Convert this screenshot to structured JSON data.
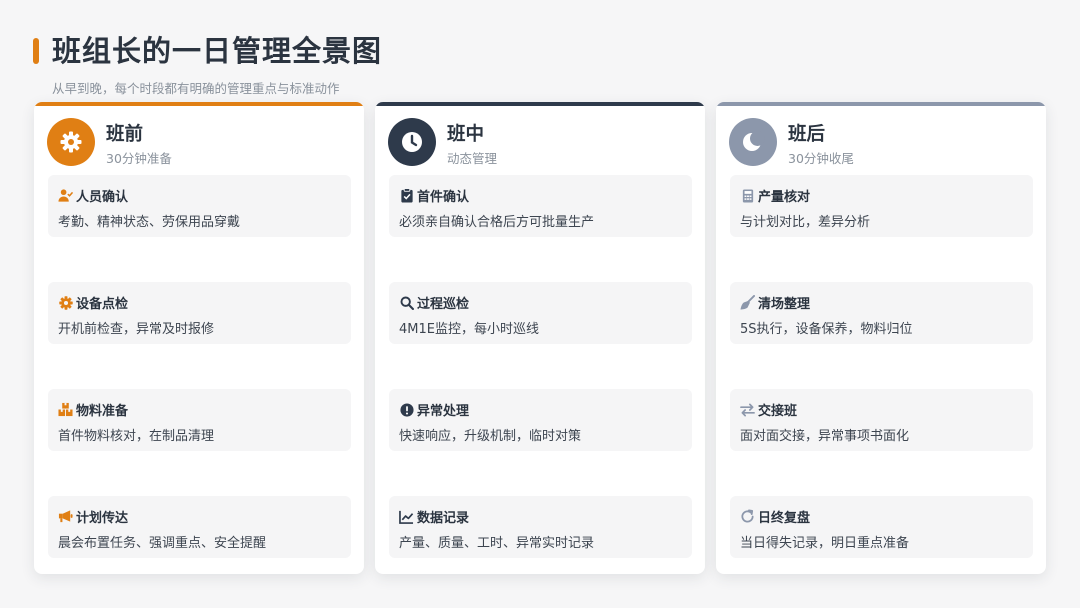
{
  "title": "班组长的一日管理全景图",
  "subtitle": "从早到晚，每个时段都有明确的管理重点与标准动作",
  "colors": {
    "accent_orange": "#e07f14",
    "navy": "#2e3a4b",
    "slate": "#8c97ab"
  },
  "columns": [
    {
      "title": "班前",
      "subtitle": "30分钟准备",
      "icon": "gear-icon",
      "items": [
        {
          "icon": "user-check-icon",
          "title": "人员确认",
          "desc": "考勤、精神状态、劳保用品穿戴"
        },
        {
          "icon": "cog-icon",
          "title": "设备点检",
          "desc": "开机前检查，异常及时报修"
        },
        {
          "icon": "boxes-icon",
          "title": "物料准备",
          "desc": "首件物料核对，在制品清理"
        },
        {
          "icon": "megaphone-icon",
          "title": "计划传达",
          "desc": "晨会布置任务、强调重点、安全提醒"
        }
      ]
    },
    {
      "title": "班中",
      "subtitle": "动态管理",
      "icon": "clock-icon",
      "items": [
        {
          "icon": "clipboard-check-icon",
          "title": "首件确认",
          "desc": "必须亲自确认合格后方可批量生产"
        },
        {
          "icon": "search-icon",
          "title": "过程巡检",
          "desc": "4M1E监控，每小时巡线"
        },
        {
          "icon": "alert-icon",
          "title": "异常处理",
          "desc": "快速响应，升级机制，临时对策"
        },
        {
          "icon": "line-chart-icon",
          "title": "数据记录",
          "desc": "产量、质量、工时、异常实时记录"
        }
      ]
    },
    {
      "title": "班后",
      "subtitle": "30分钟收尾",
      "icon": "moon-icon",
      "items": [
        {
          "icon": "calculator-icon",
          "title": "产量核对",
          "desc": "与计划对比，差异分析"
        },
        {
          "icon": "broom-icon",
          "title": "清场整理",
          "desc": "5S执行，设备保养，物料归位"
        },
        {
          "icon": "exchange-icon",
          "title": "交接班",
          "desc": "面对面交接，异常事项书面化"
        },
        {
          "icon": "refresh-icon",
          "title": "日终复盘",
          "desc": "当日得失记录，明日重点准备"
        }
      ]
    }
  ]
}
